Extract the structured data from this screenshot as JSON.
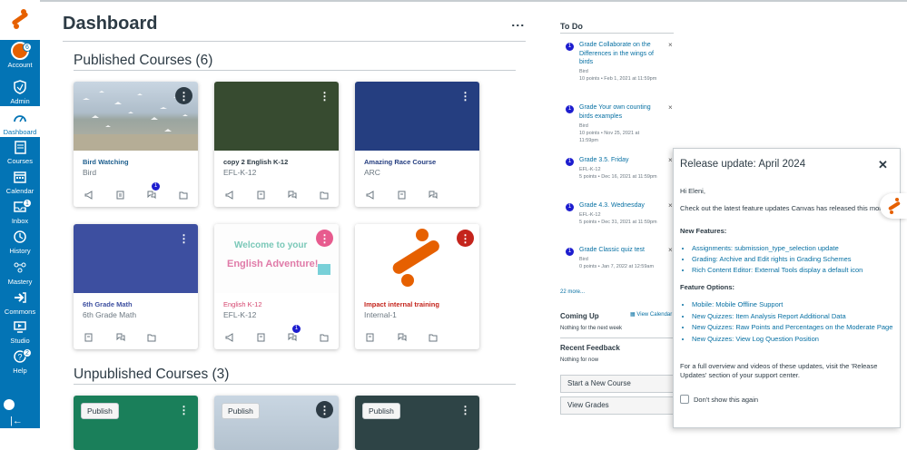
{
  "nav": {
    "items": [
      {
        "label": "Account",
        "badge": "6"
      },
      {
        "label": "Admin",
        "badge": ""
      },
      {
        "label": "Dashboard",
        "badge": ""
      },
      {
        "label": "Courses",
        "badge": ""
      },
      {
        "label": "Calendar",
        "badge": ""
      },
      {
        "label": "Inbox",
        "badge": "1"
      },
      {
        "label": "History",
        "badge": ""
      },
      {
        "label": "Mastery",
        "badge": ""
      },
      {
        "label": "Commons",
        "badge": ""
      },
      {
        "label": "Studio",
        "badge": ""
      },
      {
        "label": "Help",
        "badge": "2"
      }
    ]
  },
  "header": {
    "title": "Dashboard"
  },
  "published": {
    "title": "Published Courses (6)",
    "cards": [
      {
        "name": "Bird Watching",
        "code": "Bird",
        "color": "#2d3b45",
        "name_color": "#1e5f8e",
        "badge": "1"
      },
      {
        "name": "copy 2 English K-12",
        "code": "EFL-K-12",
        "color": "#374b30",
        "name_color": "#2d3b45",
        "badge": ""
      },
      {
        "name": "Amazing Race Course",
        "code": "ARC",
        "color": "#253e80",
        "name_color": "#253e80",
        "badge": ""
      },
      {
        "name": "6th Grade Math",
        "code": "6th Grade Math",
        "color": "#3d4fa0",
        "name_color": "#3d4fa0",
        "badge": ""
      },
      {
        "name": "English K-12",
        "code": "EFL-K-12",
        "color": "#e75b8e",
        "name_color": "#d5456e",
        "badge": "1",
        "hero_text_1": "Welcome to your",
        "hero_text_2": "English Adventure!"
      },
      {
        "name": "Impact internal training",
        "code": "Internal-1",
        "color": "#c4241c",
        "name_color": "#c4241c",
        "badge": ""
      }
    ]
  },
  "unpublished": {
    "title": "Unpublished Courses (3)",
    "publish_label": "Publish",
    "colors": [
      "#1a7f5a",
      "#8aa0b8",
      "#2e4446"
    ]
  },
  "todo": {
    "title": "To Do",
    "items": [
      {
        "n": "1",
        "title": "Grade Collaborate on the Differences in the wings of birds",
        "course": "Bird",
        "meta": "10 points • Feb 1, 2021 at 11:59pm"
      },
      {
        "n": "1",
        "title": "Grade Your own counting birds examples",
        "course": "Bird",
        "meta": "10 points • Nov 25, 2021 at 11:59pm"
      },
      {
        "n": "1",
        "title": "Grade 3.5. Friday",
        "course": "EFL-K-12",
        "meta": "5 points • Dec 16, 2021 at 11:59pm"
      },
      {
        "n": "1",
        "title": "Grade 4.3. Wednesday",
        "course": "EFL-K-12",
        "meta": "5 points • Dec 31, 2021 at 11:59pm"
      },
      {
        "n": "1",
        "title": "Grade Classic quiz test",
        "course": "Bird",
        "meta": "0 points • Jan 7, 2022 at 12:59am"
      }
    ],
    "more": "22 more...",
    "coming_up": "Coming Up",
    "view_calendar": "View Calendar",
    "coming_up_empty": "Nothing for the next week",
    "recent_feedback": "Recent Feedback",
    "feedback_empty": "Nothing for now",
    "start_course": "Start a New Course",
    "view_grades": "View Grades"
  },
  "release": {
    "title": "Release update: April 2024",
    "greeting": "Hi Eleni,",
    "intro": "Check out the latest feature updates Canvas has released this month:",
    "new_features_h": "New Features:",
    "new_features": [
      "Assignments: submission_type_selection update",
      "Grading: Archive and Edit rights in Grading Schemes",
      "Rich Content Editor: External Tools display a default icon"
    ],
    "feature_options_h": "Feature Options:",
    "feature_options": [
      "Mobile: Mobile Offline Support",
      "New Quizzes: Item Analysis Report Additional Data",
      "New Quizzes: Raw Points and Percentages on the Moderate Page",
      "New Quizzes: View Log Question Position"
    ],
    "footer": "For a full overview and videos of these updates, visit the 'Release Updates' section of your support center.",
    "dont_show": "Don't show this again"
  },
  "accent": "#0374B5",
  "brand": "#e66000"
}
